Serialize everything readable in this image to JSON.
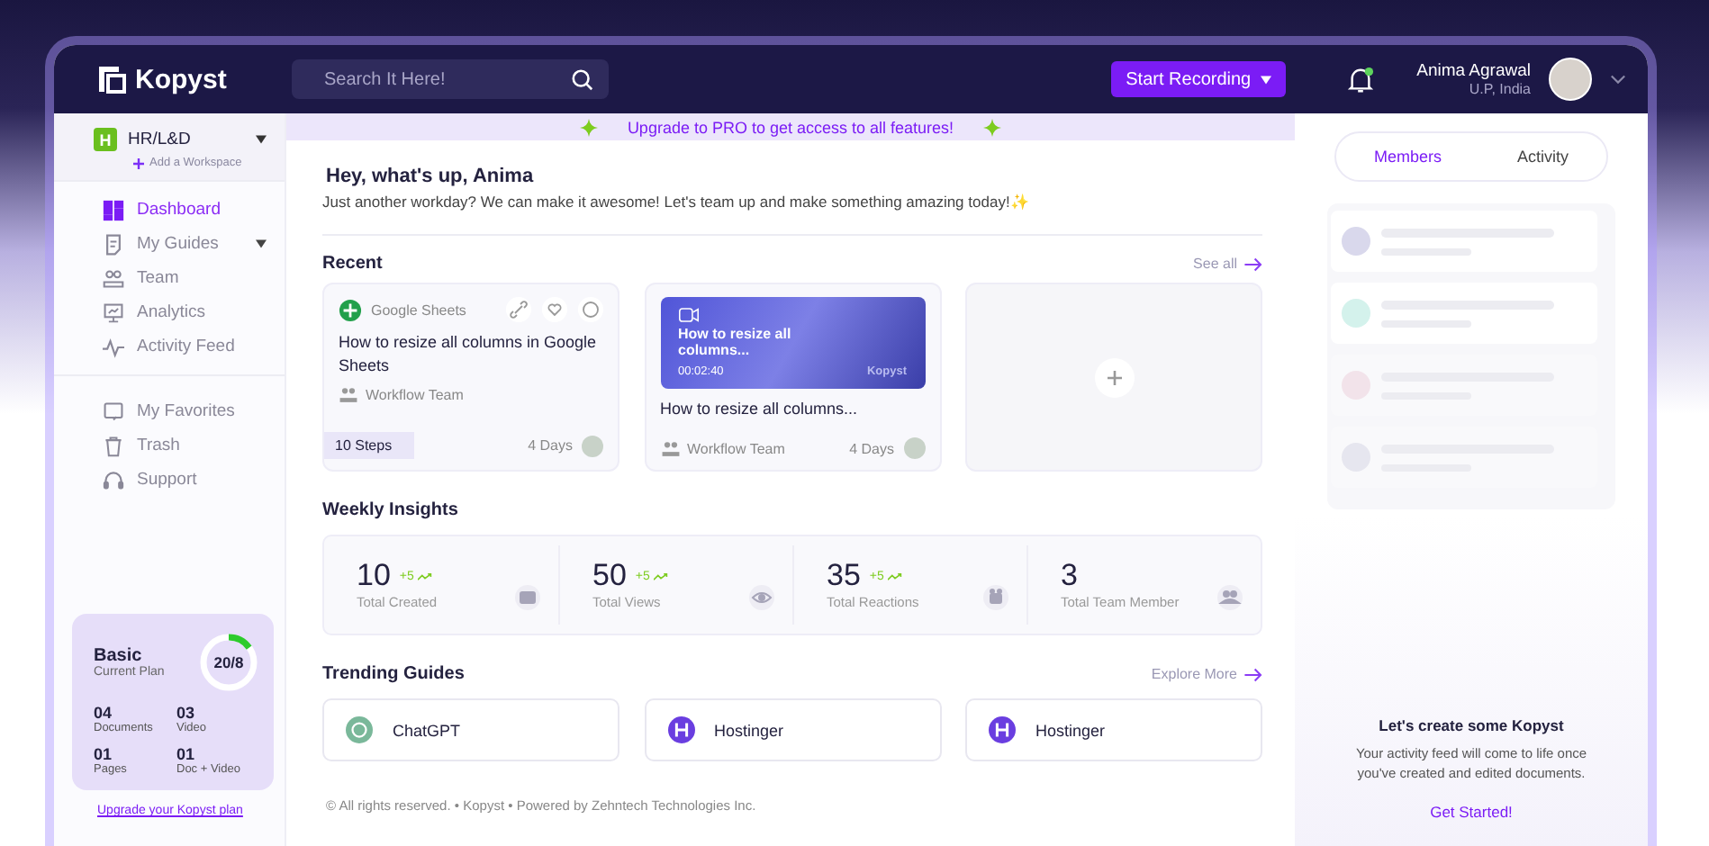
{
  "header": {
    "logo": "Kopyst",
    "search": {
      "placeholder": "Search It Here!"
    },
    "record_button": "Start Recording",
    "notification_dot": true,
    "user": {
      "name": "Anima Agrawal",
      "location": "U.P, India"
    }
  },
  "banner": "Upgrade to PRO to get access to all features!",
  "sidebar": {
    "workspace": {
      "initial": "H",
      "name": "HR/L&D",
      "add_label": "Add a Workspace"
    },
    "items": [
      {
        "label": "Dashboard",
        "selected": true,
        "caret": false
      },
      {
        "label": "My Guides",
        "selected": false,
        "caret": true
      },
      {
        "label": "Team",
        "selected": false,
        "caret": false
      },
      {
        "label": "Analytics",
        "selected": false,
        "caret": false
      },
      {
        "label": "Activity Feed",
        "selected": false,
        "caret": false
      }
    ],
    "items_2": [
      {
        "label": "My Favorites",
        "selected": false,
        "caret": false
      },
      {
        "label": "Trash",
        "selected": false,
        "caret": false
      },
      {
        "label": "Support",
        "selected": false,
        "caret": false
      }
    ],
    "plan": {
      "name": "Basic",
      "subtitle": "Current Plan",
      "usage": "20/8",
      "level": 0.15,
      "stats": [
        {
          "value": "04",
          "label": "Documents"
        },
        {
          "value": "03",
          "label": "Video"
        },
        {
          "value": "01",
          "label": "Pages"
        },
        {
          "value": "01",
          "label": "Doc + Video"
        }
      ]
    },
    "upgrade_link": "Upgrade your Kopyst plan"
  },
  "greeting": {
    "title": "Hey, what's up, Anima",
    "subtitle": "Just another workday? We can make it awesome! Let's team up and make something amazing today!✨"
  },
  "recent": {
    "title": "Recent",
    "link": "See all",
    "cards": [
      {
        "kind": "doc",
        "app": "Google Sheets",
        "title": "How to resize all columns in Google Sheets",
        "team": "Workflow Team",
        "steps": "10 Steps",
        "age": "4 Days"
      },
      {
        "kind": "video",
        "video_title": "How to resize all columns...",
        "duration": "00:02:40",
        "watermark": "Kopyst",
        "title": "How to resize all columns...",
        "team": "Workflow Team",
        "age": "4 Days"
      },
      {
        "kind": "add"
      }
    ]
  },
  "insights": {
    "title": "Weekly Insights",
    "stats": [
      {
        "value": "10",
        "delta": "+5",
        "label": "Total Created"
      },
      {
        "value": "50",
        "delta": "+5",
        "label": "Total Views"
      },
      {
        "value": "35",
        "delta": "+5",
        "label": "Total Reactions"
      },
      {
        "value": "3",
        "label": "Total Team Member"
      }
    ]
  },
  "trending": {
    "title": "Trending Guides",
    "link": "Explore More",
    "items": [
      {
        "name": "ChatGPT"
      },
      {
        "name": "Hostinger"
      },
      {
        "name": "Hostinger"
      }
    ]
  },
  "footer": "© All rights reserved. • Kopyst • Powered by Zehntech Technologies Inc.",
  "right_panel": {
    "tabs": [
      {
        "label": "Members",
        "selected": true
      },
      {
        "label": "Activity",
        "selected": false
      }
    ],
    "empty_title": "Let's create some Kopyst",
    "empty_text": "Your activity feed will come to life once you've created and edited documents.",
    "cta": "Get Started!"
  }
}
